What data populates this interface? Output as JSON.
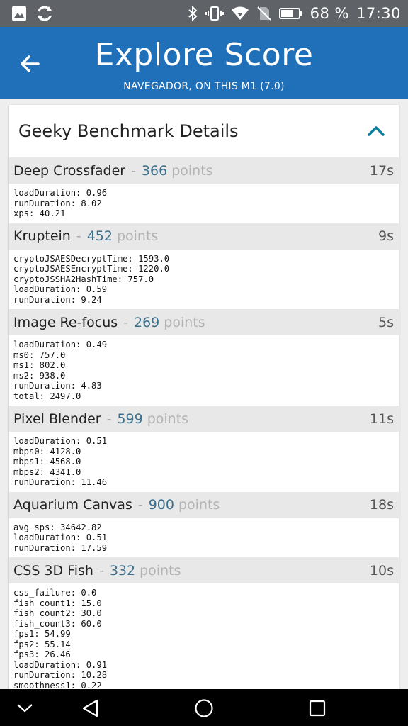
{
  "status_bar": {
    "battery_percent": "68 %",
    "time": "17:30",
    "icons": [
      "image-icon",
      "sync-icon",
      "bluetooth-icon",
      "vibrate-icon",
      "wifi-icon",
      "no-sim-icon",
      "battery-icon"
    ]
  },
  "app_bar": {
    "title": "Explore Score",
    "subtitle": "NAVEGADOR, ON THIS M1 (7.0)",
    "color": "#1f6fb9"
  },
  "card": {
    "title": "Geeky Benchmark Details",
    "accent_color": "#0d7f9f"
  },
  "tests": [
    {
      "name": "Deep Crossfader",
      "separator": "-",
      "score": "366",
      "unit": "points",
      "time": "17s",
      "details": [
        "loadDuration: 0.96",
        "runDuration: 8.02",
        "xps: 40.21"
      ]
    },
    {
      "name": "Kruptein",
      "separator": "-",
      "score": "452",
      "unit": "points",
      "time": "9s",
      "details": [
        "cryptoJSAESDecryptTime: 1593.0",
        "cryptoJSAESEncryptTime: 1220.0",
        "cryptoJSSHA2HashTime: 757.0",
        "loadDuration: 0.59",
        "runDuration: 9.24"
      ]
    },
    {
      "name": "Image Re-focus",
      "separator": "-",
      "score": "269",
      "unit": "points",
      "time": "5s",
      "details": [
        "loadDuration: 0.49",
        "ms0: 757.0",
        "ms1: 802.0",
        "ms2: 938.0",
        "runDuration: 4.83",
        "total: 2497.0"
      ]
    },
    {
      "name": "Pixel Blender",
      "separator": "-",
      "score": "599",
      "unit": "points",
      "time": "11s",
      "details": [
        "loadDuration: 0.51",
        "mbps0: 4128.0",
        "mbps1: 4568.0",
        "mbps2: 4341.0",
        "runDuration: 11.46"
      ]
    },
    {
      "name": "Aquarium Canvas",
      "separator": "-",
      "score": "900",
      "unit": "points",
      "time": "18s",
      "details": [
        "avg_sps: 34642.82",
        "loadDuration: 0.51",
        "runDuration: 17.59"
      ]
    },
    {
      "name": "CSS 3D Fish",
      "separator": "-",
      "score": "332",
      "unit": "points",
      "time": "10s",
      "details": [
        "css_failure: 0.0",
        "fish_count1: 15.0",
        "fish_count2: 30.0",
        "fish_count3: 60.0",
        "fps1: 54.99",
        "fps2: 55.14",
        "fps3: 26.46",
        "loadDuration: 0.91",
        "runDuration: 10.28",
        "smoothness1: 0.22"
      ]
    }
  ],
  "nav_bar": {
    "icons": [
      "chevron-down-icon",
      "back-triangle-icon",
      "home-circle-icon",
      "recents-square-icon"
    ]
  }
}
